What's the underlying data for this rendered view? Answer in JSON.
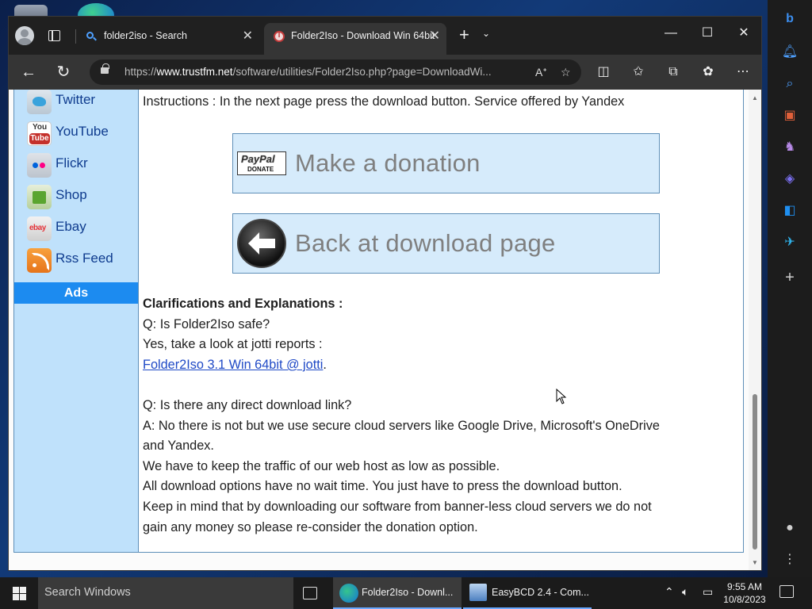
{
  "browser": {
    "tabs": [
      {
        "title": "folder2iso - Search",
        "icon": "search-icon"
      },
      {
        "title": "Folder2Iso - Download Win 64bit",
        "icon": "trustfm-favicon-icon"
      }
    ],
    "url": {
      "prefix": "https://",
      "domain": "www.trustfm.net",
      "path": "/software/utilities/Folder2Iso.php?page=DownloadWi..."
    }
  },
  "sidebar": {
    "social": [
      {
        "label": "Twitter",
        "icon": "twitter-icon"
      },
      {
        "label": "YouTube",
        "icon": "youtube-icon"
      },
      {
        "label": "Flickr",
        "icon": "flickr-icon"
      },
      {
        "label": "Shop",
        "icon": "shop-icon"
      },
      {
        "label": "Ebay",
        "icon": "ebay-icon"
      },
      {
        "label": "Rss Feed",
        "icon": "rss-icon"
      }
    ],
    "youtube_logo": {
      "top": "You",
      "bottom": "Tube"
    },
    "ebay_logo": "ebay",
    "ads_label": "Ads"
  },
  "content": {
    "instructions": "Instructions : In the next page press the download button. Service offered by Yandex",
    "donate_button": "Make a donation",
    "paypal_logo": {
      "brand": "PayPal",
      "sub": "DONATE"
    },
    "back_button": "Back at download page",
    "clarifications_heading": "Clarifications and Explanations :",
    "q1": "Q: Is Folder2Iso safe?",
    "a1": "Yes, take a look at jotti reports :",
    "jotti_link": "Folder2Iso 3.1 Win 64bit @ jotti",
    "jotti_suffix": ".",
    "q2": "Q: Is there any direct download link?",
    "a2_line1": "A: No there is not but we use secure cloud servers like Google Drive, Microsoft's OneDrive",
    "a2_line2": "and Yandex.",
    "p1": "We have to keep the traffic of our web host as low as possible.",
    "p2": "All download options have no wait time. You just have to press the download button.",
    "p3_line1": "Keep in mind that by downloading our software from banner-less cloud servers we do not",
    "p3_line2": "gain any money so please re-consider the donation option."
  },
  "taskbar": {
    "search_placeholder": "Search Windows",
    "items": [
      {
        "label": "Folder2Iso - Downl...",
        "icon": "edge-icon"
      },
      {
        "label": "EasyBCD 2.4 - Com...",
        "icon": "easybcd-icon"
      }
    ],
    "time": "9:55 AM",
    "date": "10/8/2023"
  },
  "colors": {
    "sidebar_bg": "#bfe1fb",
    "ads_bar": "#1c8bf0",
    "button_bg": "#d6ebfb",
    "link": "#1f49c6"
  }
}
